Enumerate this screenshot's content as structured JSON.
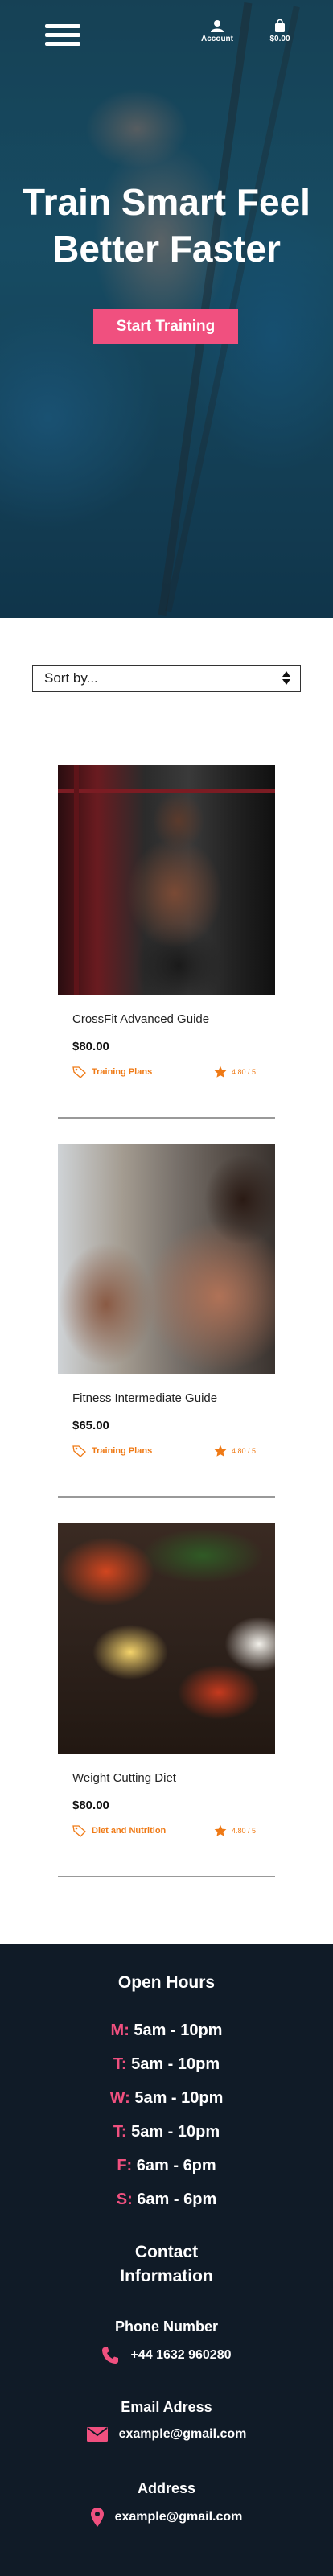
{
  "header": {
    "account_label": "Account",
    "cart_total": "$0.00"
  },
  "hero": {
    "title_line1": "Train Smart Feel",
    "title_line2": "Better Faster",
    "cta": "Start Training"
  },
  "sort": {
    "selected": "Sort by..."
  },
  "products": [
    {
      "name": "CrossFit Advanced Guide",
      "price": "$80.00",
      "category": "Training Plans",
      "rating": "4.80 / 5"
    },
    {
      "name": "Fitness Intermediate Guide",
      "price": "$65.00",
      "category": "Training Plans",
      "rating": "4.80 / 5"
    },
    {
      "name": "Weight Cutting Diet",
      "price": "$80.00",
      "category": "Diet and Nutrition",
      "rating": "4.80 / 5"
    }
  ],
  "footer": {
    "open_hours_title": "Open Hours",
    "hours": [
      {
        "day": "M:",
        "time": " 5am - 10pm"
      },
      {
        "day": "T:",
        "time": " 5am - 10pm"
      },
      {
        "day": "W:",
        "time": " 5am - 10pm"
      },
      {
        "day": "T:",
        "time": " 5am - 10pm"
      },
      {
        "day": "F:",
        "time": " 6am - 6pm"
      },
      {
        "day": "S:",
        "time": " 6am - 6pm"
      }
    ],
    "contact_title_line1": "Contact",
    "contact_title_line2": "Information",
    "phone_title": "Phone Number",
    "phone": "+44 1632 960280",
    "email_title": "Email Adress",
    "email": "example@gmail.com",
    "address_title": "Address",
    "address": "example@gmail.com"
  },
  "colors": {
    "accent_pink": "#f0507f",
    "accent_orange": "#ef7a16",
    "footer_bg": "#101b27"
  },
  "icons": [
    "menu-icon",
    "account-icon",
    "cart-bag-icon",
    "tag-icon",
    "star-icon",
    "phone-icon",
    "mail-icon",
    "location-pin-icon"
  ]
}
